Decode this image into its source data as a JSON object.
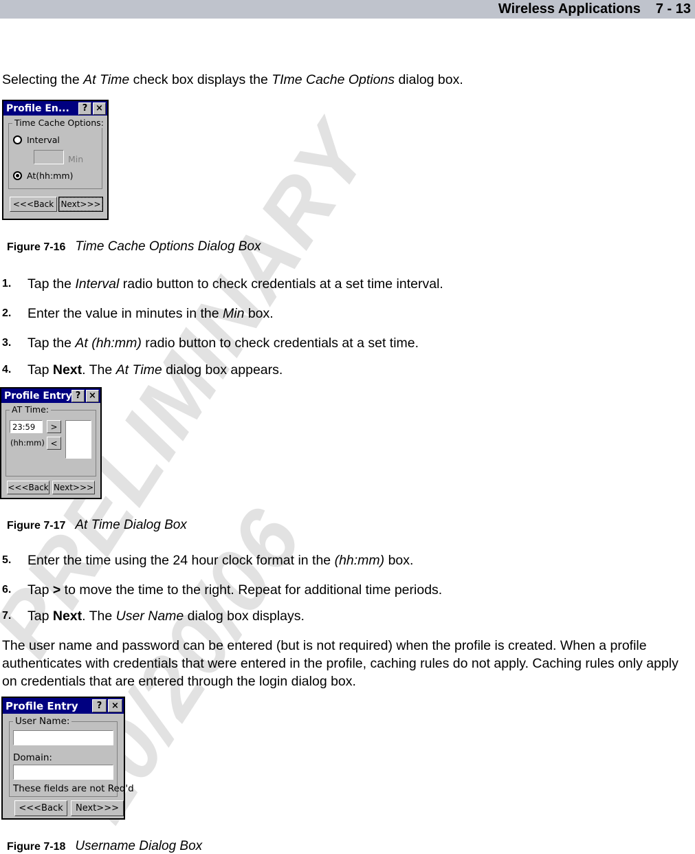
{
  "header": {
    "title": "Wireless Applications",
    "page_number": "7 - 13",
    "bar_color": "#bfc3cc"
  },
  "watermark": {
    "line1": "PRELIMINARY",
    "line2": "10/20/06",
    "color": "#e2e2e2"
  },
  "intro": {
    "prefix": "Selecting the ",
    "em1": "At Time",
    "mid": " check box displays the ",
    "em2": "TIme Cache Options",
    "suffix": " dialog box."
  },
  "figure_16": {
    "label": "Figure 7-16",
    "title": "Time Cache Options Dialog Box"
  },
  "figure_17": {
    "label": "Figure 7-17",
    "title": "At Time Dialog Box"
  },
  "figure_18": {
    "label": "Figure 7-18",
    "title": "Username Dialog Box"
  },
  "dialog_time_cache": {
    "title": "Profile En...",
    "help_btn": "?",
    "close_btn": "×",
    "group_label": "Time Cache Options:",
    "radio_interval": {
      "label": "Interval",
      "checked": false
    },
    "min_field_value": "",
    "min_label": "Min",
    "radio_at": {
      "label": "At(hh:mm)",
      "checked": true
    },
    "back_btn": "<<<Back",
    "next_btn": "Next>>>"
  },
  "dialog_at_time": {
    "title": "Profile Entry",
    "help_btn": "?",
    "close_btn": "×",
    "group_label": "AT Time:",
    "time_value": "23:59",
    "format_label": "(hh:mm)",
    "move_right_btn": ">",
    "move_left_btn": "<",
    "listbox_items": [],
    "back_btn": "<<<Back",
    "next_btn": "Next>>>"
  },
  "dialog_username": {
    "title": "Profile Entry",
    "help_btn": "?",
    "close_btn": "×",
    "group_label": "User Name:",
    "username_value": "",
    "domain_label": "Domain:",
    "domain_value": "",
    "note": "These fields are not Req'd",
    "back_btn": "<<<Back",
    "next_btn": "Next>>>"
  },
  "steps": [
    {
      "num": "1.",
      "parts": [
        {
          "t": "Tap the "
        },
        {
          "t": "Interval",
          "s": "i"
        },
        {
          "t": " radio button to check credentials at a set time interval."
        }
      ]
    },
    {
      "num": "2.",
      "parts": [
        {
          "t": "Enter the value in minutes in the "
        },
        {
          "t": "Min",
          "s": "i"
        },
        {
          "t": " box."
        }
      ]
    },
    {
      "num": "3.",
      "parts": [
        {
          "t": "Tap the "
        },
        {
          "t": "At (hh:mm)",
          "s": "i"
        },
        {
          "t": " radio button to check credentials at a set time."
        }
      ]
    },
    {
      "num": "4.",
      "parts": [
        {
          "t": "Tap "
        },
        {
          "t": "Next",
          "s": "b"
        },
        {
          "t": ". The "
        },
        {
          "t": "At Time",
          "s": "i"
        },
        {
          "t": " dialog box appears."
        }
      ]
    },
    {
      "num": "5.",
      "parts": [
        {
          "t": "Enter the time using the 24 hour clock format in the "
        },
        {
          "t": "(hh:mm)",
          "s": "i"
        },
        {
          "t": " box."
        }
      ]
    },
    {
      "num": "6.",
      "parts": [
        {
          "t": "Tap "
        },
        {
          "t": ">",
          "s": "b"
        },
        {
          "t": " to move the time to the right. Repeat for additional time periods."
        }
      ]
    },
    {
      "num": "7.",
      "parts": [
        {
          "t": "Tap "
        },
        {
          "t": "Next",
          "s": "b"
        },
        {
          "t": ". The "
        },
        {
          "t": "User Name",
          "s": "i"
        },
        {
          "t": " dialog box displays."
        }
      ]
    }
  ],
  "closing_paragraph": "The user name and password can be entered (but is not required) when the profile is created. When a profile authenticates with credentials that were entered in the profile, caching rules do not apply. Caching rules only apply on credentials that are entered through the login dialog box."
}
